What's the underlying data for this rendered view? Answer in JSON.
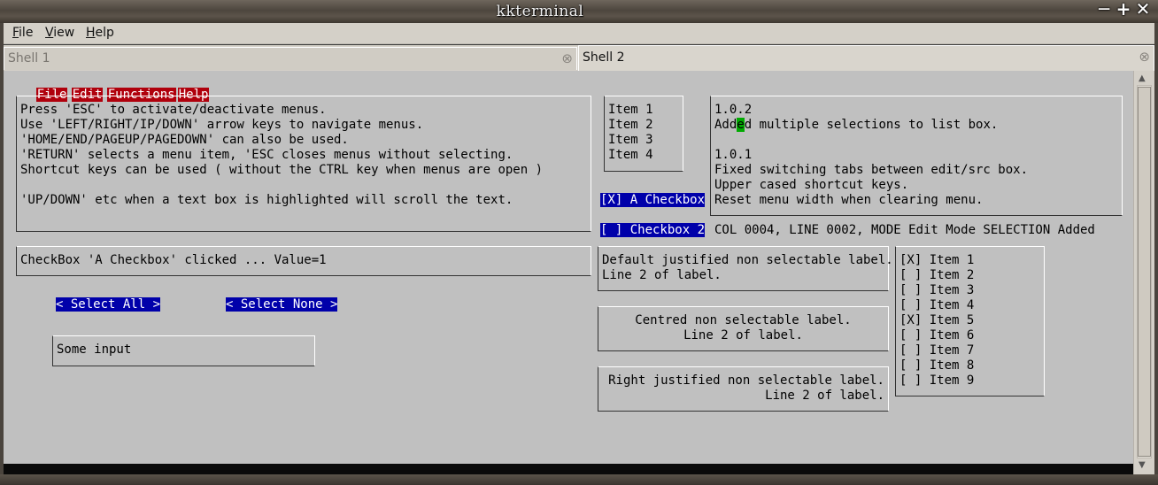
{
  "window": {
    "title": "kkterminal",
    "controls": [
      "─",
      "+",
      "✕"
    ]
  },
  "app_menu": [
    {
      "label": "File",
      "underline": "F",
      "rest": "ile"
    },
    {
      "label": "View",
      "underline": "V",
      "rest": "iew"
    },
    {
      "label": "Help",
      "underline": "H",
      "rest": "elp"
    }
  ],
  "tabs": [
    {
      "label": "Shell 1",
      "close": "⊗",
      "active": false
    },
    {
      "label": "Shell 2",
      "close": "⊗",
      "active": true
    }
  ],
  "term_menu": [
    "File",
    "Edit",
    "Functions",
    "Help"
  ],
  "help_text": [
    "Press 'ESC' to activate/deactivate menus.",
    "Use 'LEFT/RIGHT/IP/DOWN' arrow keys to navigate menus.",
    "'HOME/END/PAGEUP/PAGEDOWN' can also be used.",
    "'RETURN' selects a menu item, 'ESC closes menus without selecting.",
    "Shortcut keys can be used ( without the CTRL key when menus are open )",
    "",
    "'UP/DOWN' etc when a text box is highlighted will scroll the text."
  ],
  "list_items": [
    "Item 1",
    "Item 2",
    "Item 3",
    "Item 4"
  ],
  "changelog": {
    "line1": "1.0.2",
    "line2_pre": "Add",
    "line2_hl": "e",
    "line2_post": "d multiple selections to list box.",
    "rest": [
      "",
      "1.0.1",
      "Fixed switching tabs between edit/src box.",
      "Upper cased shortcut keys.",
      "Reset menu width when clearing menu."
    ]
  },
  "checkbox1": "[X] A Checkbox",
  "checkbox2": "[ ] Checkbox 2",
  "status": "COL 0004, LINE 0002, MODE Edit Mode SELECTION Added",
  "message": "CheckBox 'A Checkbox' clicked ... Value=1",
  "select_all": "< Select All >",
  "select_none": "< Select None >",
  "input_value": "Some input",
  "labels": {
    "default": [
      "Default justified non selectable label.",
      "Line 2 of label."
    ],
    "centred": [
      "Centred non selectable label.",
      "Line 2 of label."
    ],
    "right": [
      "Right justified non selectable label.",
      "Line 2 of label."
    ]
  },
  "multi_list": [
    "[X] Item 1",
    "[ ] Item 2",
    "[ ] Item 3",
    "[ ] Item 4",
    "[X] Item 5",
    "[ ] Item 6",
    "[ ] Item 7",
    "[ ] Item 8",
    "[ ] Item 9"
  ],
  "colors": {
    "menu_red": "#b0000c",
    "button_blue": "#0000aa",
    "highlight_green": "#00aa00",
    "term_bg": "#c0c0c0"
  }
}
